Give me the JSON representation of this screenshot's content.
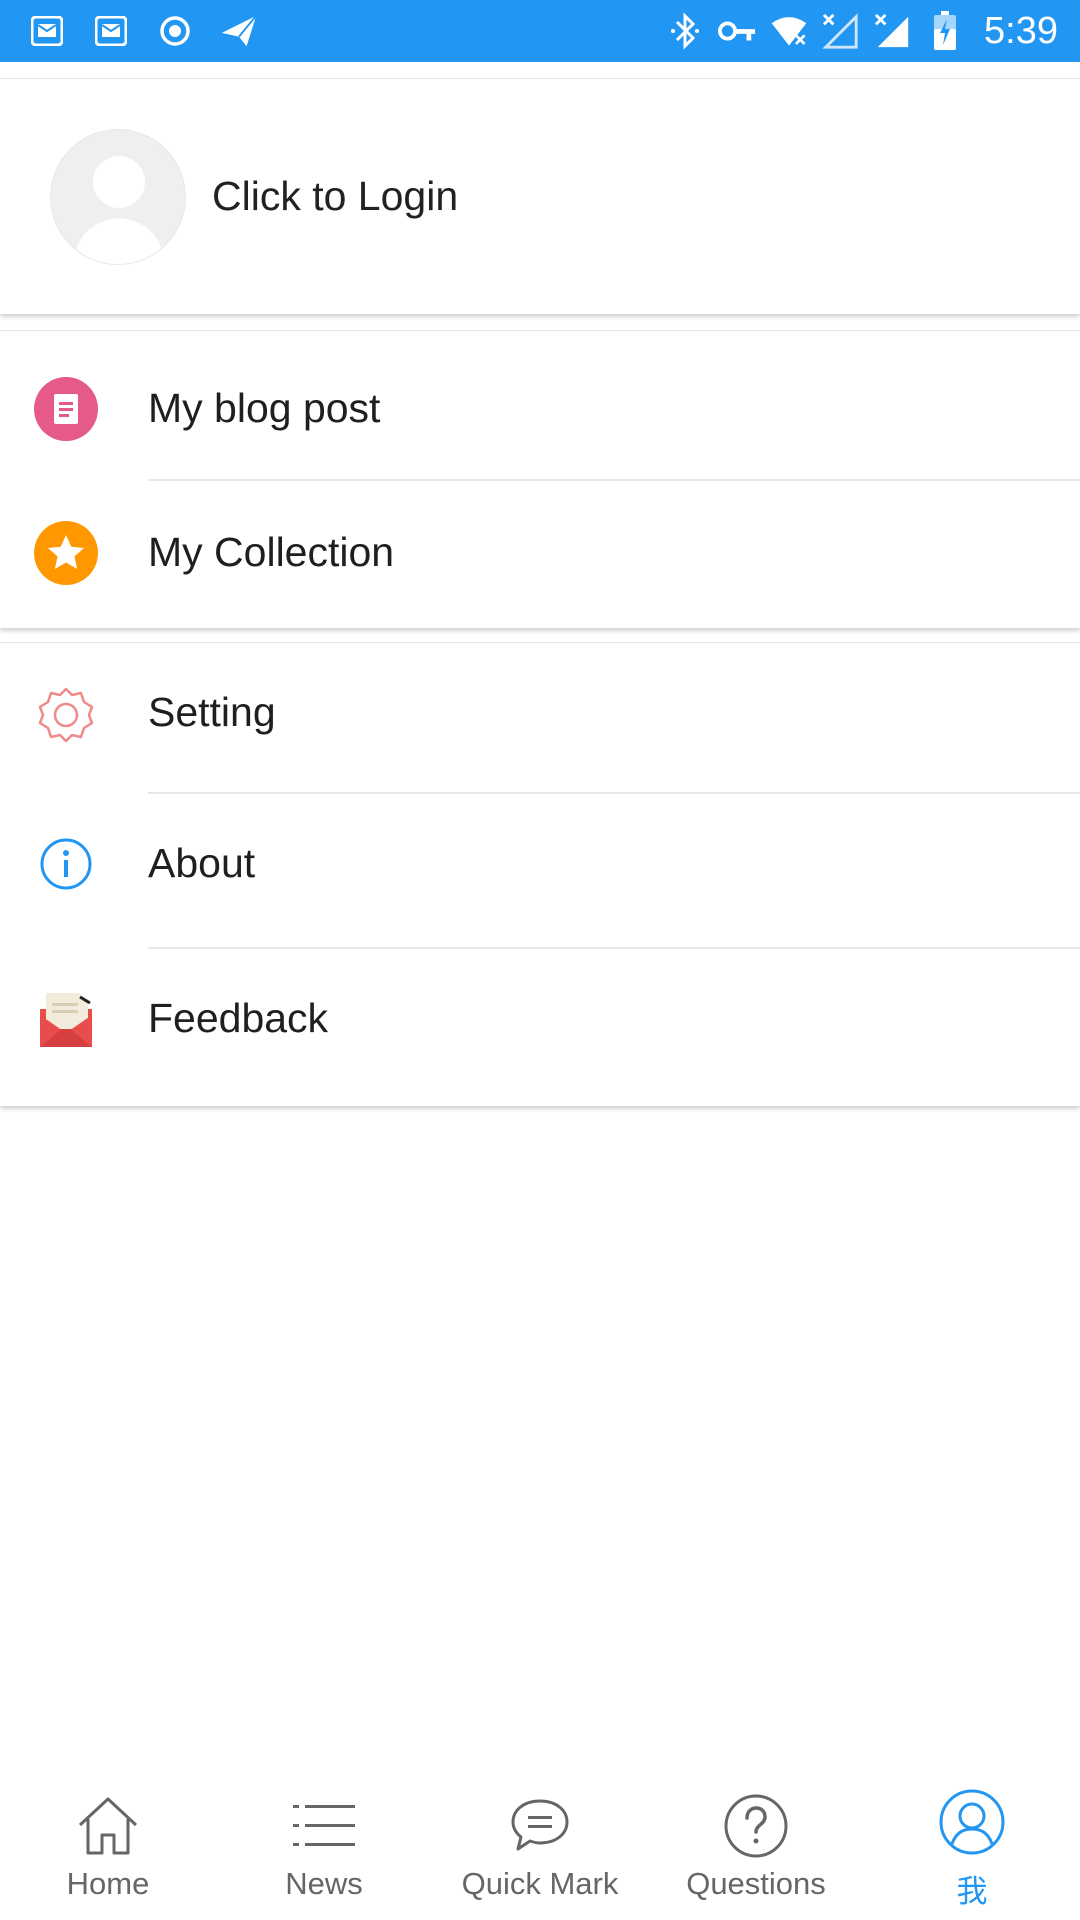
{
  "status_bar": {
    "time": "5:39",
    "background_color": "#2196F3",
    "left_icons": [
      "mail-icon",
      "mail-icon",
      "record-icon",
      "send-icon"
    ],
    "right_icons": [
      "bluetooth-icon",
      "vpn-key-icon",
      "wifi-icon",
      "signal-icon",
      "signal-icon",
      "battery-charging-icon"
    ]
  },
  "login": {
    "label": "Click to Login",
    "avatar_icon": "default-avatar-icon"
  },
  "menu_group_1": [
    {
      "label": "My blog post",
      "icon": "blog-post-icon",
      "color": "#E65A8A"
    },
    {
      "label": "My Collection",
      "icon": "star-icon",
      "color": "#FF9800"
    }
  ],
  "menu_group_2": [
    {
      "label": "Setting",
      "icon": "gear-icon",
      "color": "#F08A8A"
    },
    {
      "label": "About",
      "icon": "info-icon",
      "color": "#2196F3"
    },
    {
      "label": "Feedback",
      "icon": "envelope-icon",
      "color": "#E84C4C"
    }
  ],
  "tabs": [
    {
      "label": "Home",
      "icon": "home-icon",
      "active": false
    },
    {
      "label": "News",
      "icon": "list-icon",
      "active": false
    },
    {
      "label": "Quick Mark",
      "icon": "chat-bubble-icon",
      "active": false
    },
    {
      "label": "Questions",
      "icon": "question-icon",
      "active": false
    },
    {
      "label": "我",
      "icon": "profile-icon",
      "active": true
    }
  ],
  "colors": {
    "accent": "#2196F3",
    "tab_inactive": "#666666"
  }
}
